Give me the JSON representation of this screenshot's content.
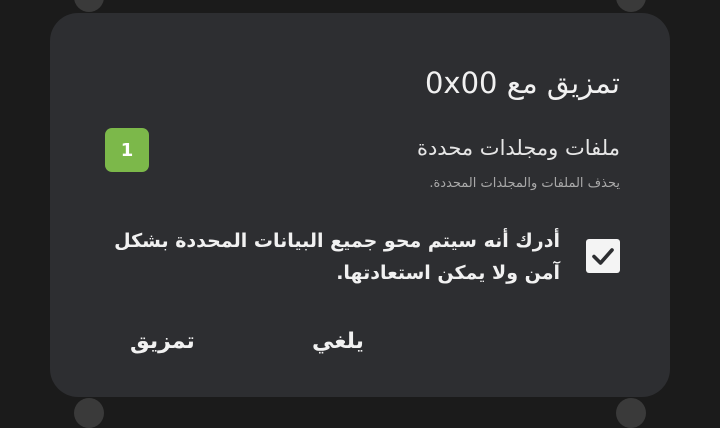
{
  "dialog": {
    "title": "تمزيق مع 0x00",
    "item": {
      "title": "ملفات ومجلدات محددة",
      "description": "يحذف الملفات والمجلدات المحددة.",
      "count": "1"
    },
    "acknowledge": {
      "checked": true,
      "text": "أدرك أنه سيتم محو جميع البيانات المحددة بشكل آمن ولا يمكن استعادتها."
    },
    "buttons": {
      "cancel_label": "يلغي",
      "shred_label": "تمزيق"
    }
  },
  "colors": {
    "dialog_bg": "#2d2e31",
    "badge": "#7cb84a",
    "checkbox": "#f4f4f4"
  }
}
